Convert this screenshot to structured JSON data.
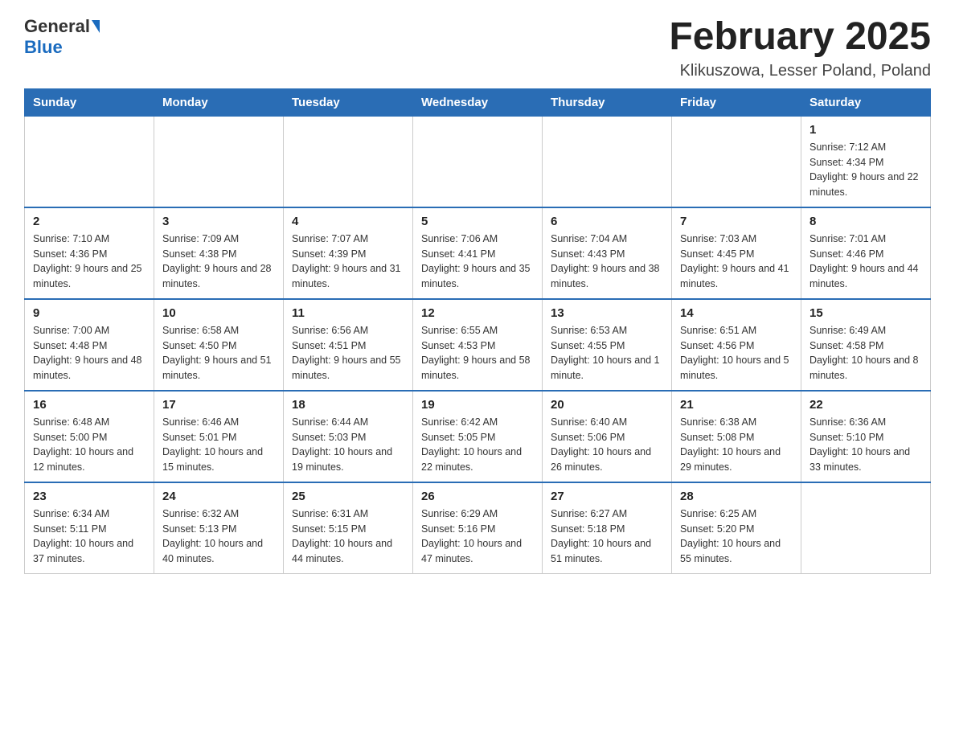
{
  "logo": {
    "general": "General",
    "blue": "Blue"
  },
  "title": "February 2025",
  "subtitle": "Klikuszowa, Lesser Poland, Poland",
  "days_of_week": [
    "Sunday",
    "Monday",
    "Tuesday",
    "Wednesday",
    "Thursday",
    "Friday",
    "Saturday"
  ],
  "weeks": [
    [
      {
        "day": "",
        "info": ""
      },
      {
        "day": "",
        "info": ""
      },
      {
        "day": "",
        "info": ""
      },
      {
        "day": "",
        "info": ""
      },
      {
        "day": "",
        "info": ""
      },
      {
        "day": "",
        "info": ""
      },
      {
        "day": "1",
        "info": "Sunrise: 7:12 AM\nSunset: 4:34 PM\nDaylight: 9 hours and 22 minutes."
      }
    ],
    [
      {
        "day": "2",
        "info": "Sunrise: 7:10 AM\nSunset: 4:36 PM\nDaylight: 9 hours and 25 minutes."
      },
      {
        "day": "3",
        "info": "Sunrise: 7:09 AM\nSunset: 4:38 PM\nDaylight: 9 hours and 28 minutes."
      },
      {
        "day": "4",
        "info": "Sunrise: 7:07 AM\nSunset: 4:39 PM\nDaylight: 9 hours and 31 minutes."
      },
      {
        "day": "5",
        "info": "Sunrise: 7:06 AM\nSunset: 4:41 PM\nDaylight: 9 hours and 35 minutes."
      },
      {
        "day": "6",
        "info": "Sunrise: 7:04 AM\nSunset: 4:43 PM\nDaylight: 9 hours and 38 minutes."
      },
      {
        "day": "7",
        "info": "Sunrise: 7:03 AM\nSunset: 4:45 PM\nDaylight: 9 hours and 41 minutes."
      },
      {
        "day": "8",
        "info": "Sunrise: 7:01 AM\nSunset: 4:46 PM\nDaylight: 9 hours and 44 minutes."
      }
    ],
    [
      {
        "day": "9",
        "info": "Sunrise: 7:00 AM\nSunset: 4:48 PM\nDaylight: 9 hours and 48 minutes."
      },
      {
        "day": "10",
        "info": "Sunrise: 6:58 AM\nSunset: 4:50 PM\nDaylight: 9 hours and 51 minutes."
      },
      {
        "day": "11",
        "info": "Sunrise: 6:56 AM\nSunset: 4:51 PM\nDaylight: 9 hours and 55 minutes."
      },
      {
        "day": "12",
        "info": "Sunrise: 6:55 AM\nSunset: 4:53 PM\nDaylight: 9 hours and 58 minutes."
      },
      {
        "day": "13",
        "info": "Sunrise: 6:53 AM\nSunset: 4:55 PM\nDaylight: 10 hours and 1 minute."
      },
      {
        "day": "14",
        "info": "Sunrise: 6:51 AM\nSunset: 4:56 PM\nDaylight: 10 hours and 5 minutes."
      },
      {
        "day": "15",
        "info": "Sunrise: 6:49 AM\nSunset: 4:58 PM\nDaylight: 10 hours and 8 minutes."
      }
    ],
    [
      {
        "day": "16",
        "info": "Sunrise: 6:48 AM\nSunset: 5:00 PM\nDaylight: 10 hours and 12 minutes."
      },
      {
        "day": "17",
        "info": "Sunrise: 6:46 AM\nSunset: 5:01 PM\nDaylight: 10 hours and 15 minutes."
      },
      {
        "day": "18",
        "info": "Sunrise: 6:44 AM\nSunset: 5:03 PM\nDaylight: 10 hours and 19 minutes."
      },
      {
        "day": "19",
        "info": "Sunrise: 6:42 AM\nSunset: 5:05 PM\nDaylight: 10 hours and 22 minutes."
      },
      {
        "day": "20",
        "info": "Sunrise: 6:40 AM\nSunset: 5:06 PM\nDaylight: 10 hours and 26 minutes."
      },
      {
        "day": "21",
        "info": "Sunrise: 6:38 AM\nSunset: 5:08 PM\nDaylight: 10 hours and 29 minutes."
      },
      {
        "day": "22",
        "info": "Sunrise: 6:36 AM\nSunset: 5:10 PM\nDaylight: 10 hours and 33 minutes."
      }
    ],
    [
      {
        "day": "23",
        "info": "Sunrise: 6:34 AM\nSunset: 5:11 PM\nDaylight: 10 hours and 37 minutes."
      },
      {
        "day": "24",
        "info": "Sunrise: 6:32 AM\nSunset: 5:13 PM\nDaylight: 10 hours and 40 minutes."
      },
      {
        "day": "25",
        "info": "Sunrise: 6:31 AM\nSunset: 5:15 PM\nDaylight: 10 hours and 44 minutes."
      },
      {
        "day": "26",
        "info": "Sunrise: 6:29 AM\nSunset: 5:16 PM\nDaylight: 10 hours and 47 minutes."
      },
      {
        "day": "27",
        "info": "Sunrise: 6:27 AM\nSunset: 5:18 PM\nDaylight: 10 hours and 51 minutes."
      },
      {
        "day": "28",
        "info": "Sunrise: 6:25 AM\nSunset: 5:20 PM\nDaylight: 10 hours and 55 minutes."
      },
      {
        "day": "",
        "info": ""
      }
    ]
  ]
}
